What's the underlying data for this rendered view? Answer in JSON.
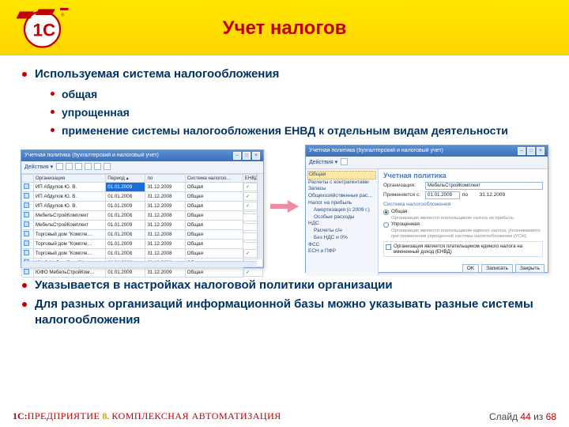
{
  "title": "Учет налогов",
  "bullets": {
    "b1": "Используемая система налогообложения",
    "sub1": "общая",
    "sub2": "упрощенная",
    "sub3": "применение системы налогообложения ЕНВД к отдельным видам деятельности",
    "b2": "Указывается в настройках налоговой политики организации",
    "b3": "Для разных организаций информационной базы можно указывать разные системы налогообложения"
  },
  "winL": {
    "title": "Учетная политика (бухгалтерский и налоговый учет)",
    "actions": "Действия ▾",
    "cols": {
      "org": "Организация",
      "period": "Период ▴",
      "to": "по",
      "sys": "Система налогоо…",
      "envd": "ЕНВД"
    },
    "rows": [
      {
        "org": "ИП Абдулов Ю. В.",
        "from": "01.01.2009",
        "to": "31.12.2009",
        "sys": "Общая",
        "chk": "✓",
        "sel": true
      },
      {
        "org": "ИП Абдулов Ю. В.",
        "from": "01.01.2008",
        "to": "31.12.2008",
        "sys": "Общая",
        "chk": "✓"
      },
      {
        "org": "ИП Абдулов Ю. В.",
        "from": "01.01.2009",
        "to": "31.12.2009",
        "sys": "Общая",
        "chk": "✓"
      },
      {
        "org": "МебельСтройКомплект",
        "from": "01.01.2008",
        "to": "31.12.2008",
        "sys": "Общая",
        "chk": ""
      },
      {
        "org": "МебельСтройКомплект",
        "from": "01.01.2009",
        "to": "31.12.2009",
        "sys": "Общая",
        "chk": ""
      },
      {
        "org": "Торговый дом \"Компле…",
        "from": "01.01.2008",
        "to": "31.12.2008",
        "sys": "Общая",
        "chk": ""
      },
      {
        "org": "Торговый дом \"Компле…",
        "from": "01.01.2009",
        "to": "31.12.2009",
        "sys": "Общая",
        "chk": ""
      },
      {
        "org": "Торговый дом \"Компле…",
        "from": "01.01.2008",
        "to": "31.12.2008",
        "sys": "Общая",
        "chk": "✓"
      },
      {
        "org": "ЮФО МебельСтройКом…",
        "from": "01.01.2008",
        "to": "31.12.2008",
        "sys": "Общая",
        "chk": "✓"
      },
      {
        "org": "ЮФО МебельСтройКом…",
        "from": "01.01.2009",
        "to": "31.12.2009",
        "sys": "Общая",
        "chk": "✓"
      }
    ]
  },
  "winR": {
    "title": "Учетная политика (бухгалтерский и налоговый учет)",
    "actions": "Действия ▾",
    "sidebar": [
      "Общая",
      "Расчеты с контрагентами",
      "Запасы",
      "Общехозяйственные расходы",
      "Налог на прибыль",
      "Амортизация (с 2009 г.)",
      "Особые расходы",
      "НДС",
      "Расчеты с/н",
      "Без НДС и 0%",
      "ФСС",
      "ЕСН и ПФР"
    ],
    "sidebar_sel": 0,
    "form_header": "Учетная политика",
    "org_lab": "Организация:",
    "org_val": "МебельСтройКомплект",
    "date_lab": "Применяется с:",
    "date_from": "01.01.2009",
    "date_to_lab": "по",
    "date_to": "31.12.2009",
    "group": "Система налогообложения",
    "opt1": "Общая",
    "opt1_hint": "Организация является плательщиком налога на прибыль.",
    "opt2": "Упрощенная",
    "opt2_hint": "Организация является плательщиком единого налога, уплачиваемого при применении упрощенной системы налогообложения (УСН).",
    "envd_chk": "Организация является плательщиком единого налога на вмененный доход (ЕНВД)",
    "ok": "OK",
    "save": "Записать",
    "close": "Закрыть"
  },
  "footer": {
    "prod_1c": "1С:",
    "prod_name": "ПРЕДПРИЯТИЕ",
    "prod_v": " 8. ",
    "prod_suffix": "КОМПЛЕКСНАЯ АВТОМАТИЗАЦИЯ",
    "slide_pre": "Слайд ",
    "slide_n": "44",
    "slide_mid": " из ",
    "slide_tot": "68"
  }
}
